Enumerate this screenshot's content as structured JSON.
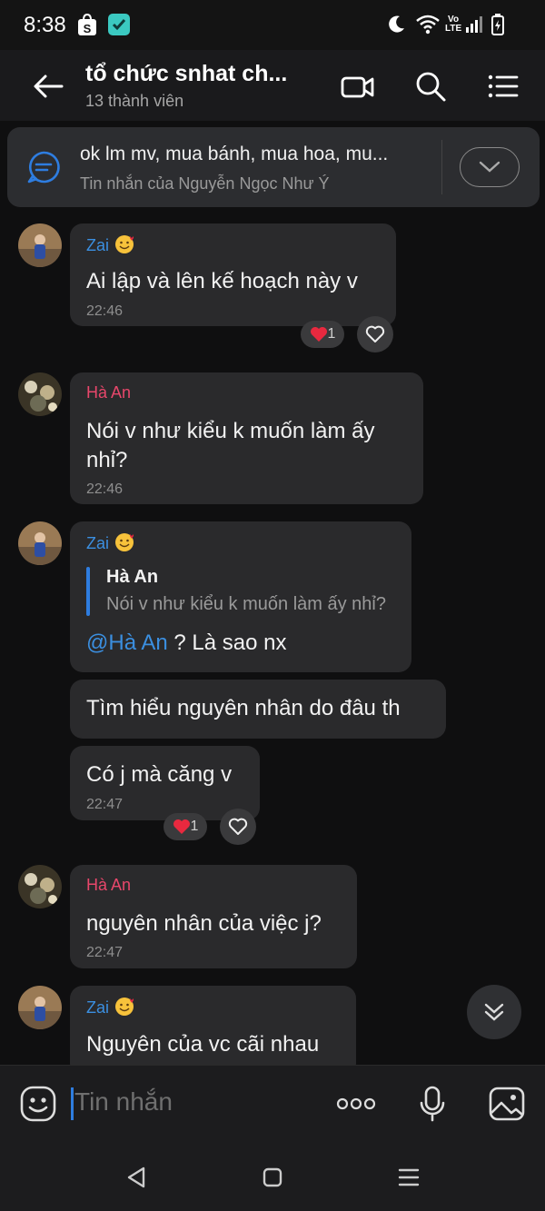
{
  "status_bar": {
    "time": "8:38",
    "network": "LTE"
  },
  "header": {
    "title": "tổ chức snhat ch...",
    "subtitle": "13 thành viên"
  },
  "pinned": {
    "text": "ok lm mv, mua bánh, mua hoa, mu...",
    "sub": "Tin nhắn của Nguyễn Ngọc Như Ý"
  },
  "messages": [
    {
      "sender": "Zai",
      "text": "Ai lập và lên kế hoạch này v",
      "time": "22:46",
      "reaction_count": "1"
    },
    {
      "sender": "Hà An",
      "text_line1": "Nói v như kiểu k muốn làm ấy",
      "text_line2": "nhỉ?",
      "time": "22:46"
    },
    {
      "sender": "Zai",
      "quote_name": "Hà An",
      "quote_text": "Nói v như kiểu k muốn làm ấy nhỉ?",
      "mention": "@Hà An",
      "text": " ? Là sao nx"
    },
    {
      "text": "Tìm hiểu nguyên nhân do đâu th"
    },
    {
      "text": "Có j mà căng v",
      "time": "22:47",
      "reaction_count": "1"
    },
    {
      "sender": "Hà An",
      "text": "nguyên nhân của việc j?",
      "time": "22:47"
    },
    {
      "sender": "Zai",
      "text": "Nguyên của vc cãi nhau"
    }
  ],
  "input": {
    "placeholder": "Tin nhắn"
  },
  "colors": {
    "accent": "#2e7de0",
    "sender_blue": "#3b8fe0",
    "sender_pink": "#e8476b",
    "heart": "#e8293f"
  }
}
